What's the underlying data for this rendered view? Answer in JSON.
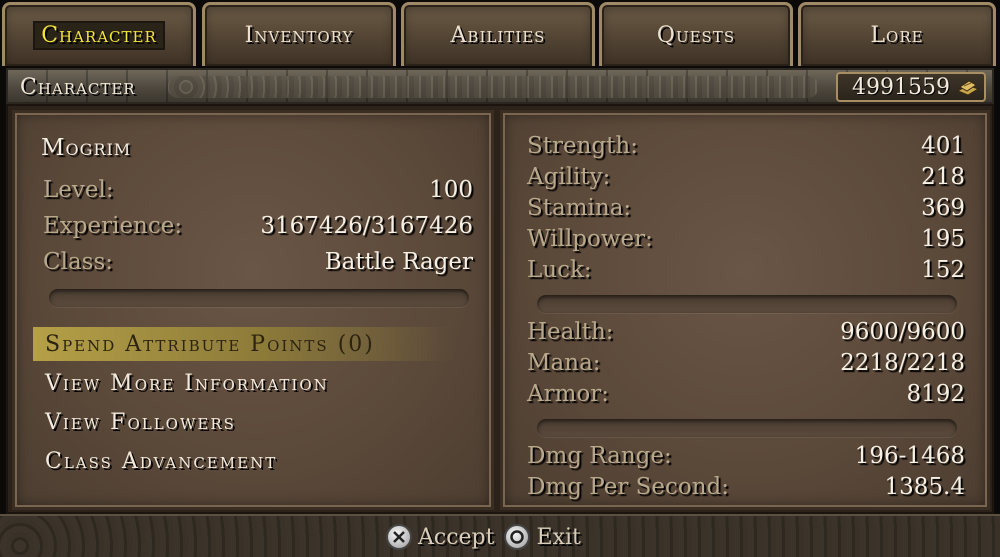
{
  "tabs": [
    {
      "label": "Character",
      "active": true
    },
    {
      "label": "Inventory",
      "active": false
    },
    {
      "label": "Abilities",
      "active": false
    },
    {
      "label": "Quests",
      "active": false
    },
    {
      "label": "Lore",
      "active": false
    }
  ],
  "header": {
    "title": "Character",
    "gold": "4991559",
    "gold_icon": "gold-pile-icon"
  },
  "character": {
    "name": "Mogrim",
    "stats": [
      {
        "label": "Level:",
        "value": "100"
      },
      {
        "label": "Experience:",
        "value": "3167426/3167426"
      },
      {
        "label": "Class:",
        "value": "Battle Rager"
      }
    ]
  },
  "menu": [
    {
      "label": "Spend Attribute Points (0)",
      "selected": true
    },
    {
      "label": "View More Information",
      "selected": false
    },
    {
      "label": "View Followers",
      "selected": false
    },
    {
      "label": "Class Advancement",
      "selected": false
    }
  ],
  "attributes": [
    {
      "label": "Strength:",
      "value": "401"
    },
    {
      "label": "Agility:",
      "value": "218"
    },
    {
      "label": "Stamina:",
      "value": "369"
    },
    {
      "label": "Willpower:",
      "value": "195"
    },
    {
      "label": "Luck:",
      "value": "152"
    }
  ],
  "vitals": [
    {
      "label": "Health:",
      "value": "9600/9600"
    },
    {
      "label": "Mana:",
      "value": "2218/2218"
    },
    {
      "label": "Armor:",
      "value": "8192"
    }
  ],
  "damage": [
    {
      "label": "Dmg Range:",
      "value": "196-1468"
    },
    {
      "label": "Dmg Per Second:",
      "value": "1385.4"
    }
  ],
  "footer": {
    "accept_label": "Accept",
    "exit_label": "Exit",
    "accept_icon": "cross-button-icon",
    "exit_icon": "circle-button-icon"
  },
  "colors": {
    "active_tab_text": "#f3e23a",
    "label": "#b8a88c",
    "value": "#f6f0e4",
    "selected_bg": "#b5a047"
  }
}
